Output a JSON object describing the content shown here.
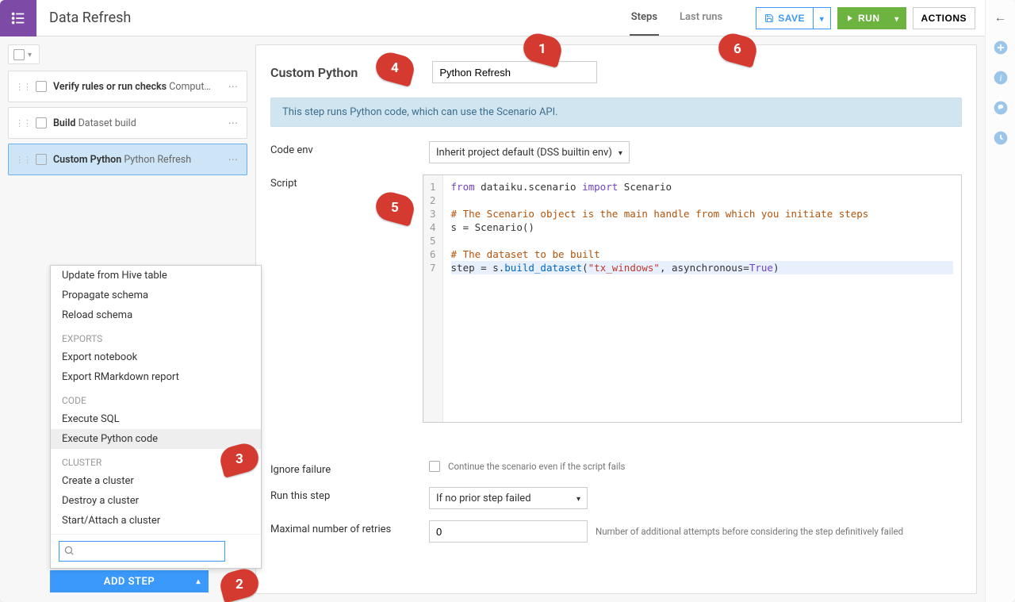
{
  "header": {
    "title": "Data Refresh",
    "tabs": {
      "steps": "Steps",
      "lastRuns": "Last runs"
    },
    "save": "SAVE",
    "run": "RUN",
    "actions": "ACTIONS"
  },
  "steps": [
    {
      "type": "Verify rules or run checks",
      "name": "Comput…"
    },
    {
      "type": "Build",
      "name": "Dataset build"
    },
    {
      "type": "Custom Python",
      "name": "Python Refresh"
    }
  ],
  "panel": {
    "title": "Custom Python",
    "nameValue": "Python Refresh",
    "info": "This step runs Python code, which can use the Scenario API.",
    "labels": {
      "codeEnv": "Code env",
      "script": "Script",
      "ignoreFailure": "Ignore failure",
      "runThis": "Run this step",
      "maxRetries": "Maximal number of retries"
    },
    "codeEnv": "Inherit project default (DSS builtin env)",
    "ignoreFailureHint": "Continue the scenario even if the script fails",
    "runThisValue": "If no prior step failed",
    "maxRetriesValue": "0",
    "maxRetriesHint": "Number of additional attempts before considering the step definitively failed"
  },
  "chart_data": {
    "type": "table",
    "title": "Script",
    "columns": [
      "line",
      "code"
    ],
    "rows": [
      [
        1,
        "from dataiku.scenario import Scenario"
      ],
      [
        2,
        ""
      ],
      [
        3,
        "# The Scenario object is the main handle from which you initiate steps"
      ],
      [
        4,
        "s = Scenario()"
      ],
      [
        5,
        ""
      ],
      [
        6,
        "# The dataset to be built"
      ],
      [
        7,
        "step = s.build_dataset(\"tx_windows\", asynchronous=True)"
      ]
    ]
  },
  "dropdown": {
    "groups": [
      {
        "label": "",
        "items": [
          "Update from Hive table",
          "Propagate schema",
          "Reload schema"
        ]
      },
      {
        "label": "EXPORTS",
        "items": [
          "Export notebook",
          "Export RMarkdown report"
        ]
      },
      {
        "label": "CODE",
        "items": [
          "Execute SQL",
          "Execute Python code"
        ]
      },
      {
        "label": "CLUSTER",
        "items": [
          "Create a cluster",
          "Destroy a cluster",
          "Start/Attach a cluster"
        ]
      }
    ],
    "highlighted": "Execute Python code",
    "searchPlaceholder": ""
  },
  "addStep": "ADD STEP",
  "annotations": {
    "1": "1",
    "2": "2",
    "3": "3",
    "4": "4",
    "5": "5",
    "6": "6"
  }
}
